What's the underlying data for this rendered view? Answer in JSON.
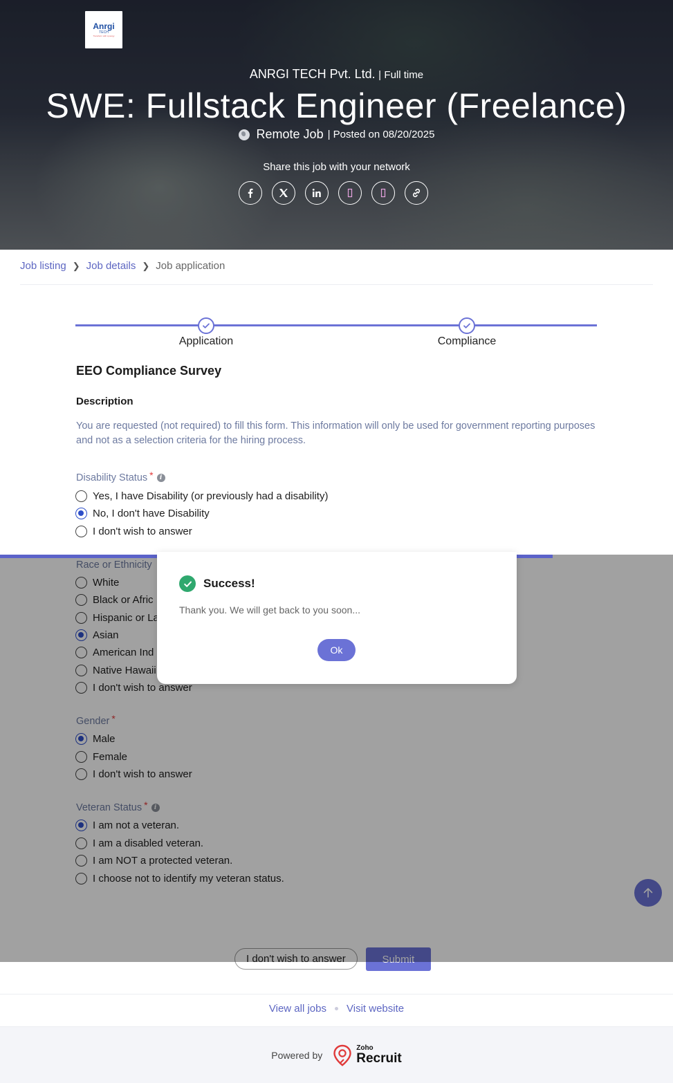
{
  "hero": {
    "logo": {
      "name": "Anrgi",
      "sub": "TECH",
      "tagline": "Transform with synergy"
    },
    "company": "ANRGI TECH Pvt. Ltd.",
    "separator": "|",
    "job_type": "Full time",
    "title": "SWE: Fullstack Engineer (Freelance)",
    "location": "Remote Job",
    "posted": "| Posted on 08/20/2025",
    "share_label": "Share this job with your network",
    "share_buttons": [
      "facebook-icon",
      "x-icon",
      "linkedin-icon",
      "share-icon-4",
      "share-icon-5",
      "link-icon"
    ]
  },
  "breadcrumb": {
    "items": [
      {
        "label": "Job listing"
      },
      {
        "label": "Job details"
      },
      {
        "label": "Job application"
      }
    ]
  },
  "stepper": {
    "steps": [
      {
        "label": "Application",
        "done": true
      },
      {
        "label": "Compliance",
        "done": true
      }
    ]
  },
  "form": {
    "title": "EEO Compliance Survey",
    "description_label": "Description",
    "description": "You are requested (not required) to fill this form. This information will only be used for government reporting purposes and not as a selection criteria for the hiring process.",
    "questions": {
      "disability": {
        "label": "Disability Status",
        "options": [
          {
            "label": "Yes, I have Disability (or previously had a disability)",
            "selected": false
          },
          {
            "label": "No, I don't have Disability",
            "selected": true
          },
          {
            "label": "I don't wish to answer",
            "selected": false
          }
        ]
      },
      "race": {
        "label": "Race or Ethnicity",
        "options": [
          {
            "label": "White",
            "selected": false
          },
          {
            "label": "Black or Afric",
            "selected": false
          },
          {
            "label": "Hispanic or La",
            "selected": false
          },
          {
            "label": "Asian",
            "selected": true
          },
          {
            "label": "American Ind",
            "selected": false
          },
          {
            "label": "Native Hawaii",
            "selected": false
          },
          {
            "label": "I don't wish to answer",
            "selected": false
          }
        ]
      },
      "gender": {
        "label": "Gender",
        "options": [
          {
            "label": "Male",
            "selected": true
          },
          {
            "label": "Female",
            "selected": false
          },
          {
            "label": "I don't wish to answer",
            "selected": false
          }
        ]
      },
      "veteran": {
        "label": "Veteran Status",
        "options": [
          {
            "label": "I am not a veteran.",
            "selected": true
          },
          {
            "label": "I am a disabled veteran.",
            "selected": false
          },
          {
            "label": "I am NOT a protected veteran.",
            "selected": false
          },
          {
            "label": "I choose not to identify my veteran status.",
            "selected": false
          }
        ]
      }
    },
    "required_mark": "*",
    "decline_button": "I don't wish to answer",
    "submit_button": "Submit"
  },
  "footer": {
    "view_all_jobs": "View all jobs",
    "visit_website": "Visit website",
    "powered_by": "Powered by",
    "brand_top": "Zoho",
    "brand_main": "Recruit"
  },
  "modal": {
    "title": "Success!",
    "message": "Thank you. We will get back to you soon...",
    "ok_button": "Ok"
  },
  "colors": {
    "accent": "#6b72d6",
    "link": "#5d66c2",
    "success": "#2fa86e",
    "radio_selected": "#2e4fc9",
    "required": "#e23b3b"
  }
}
